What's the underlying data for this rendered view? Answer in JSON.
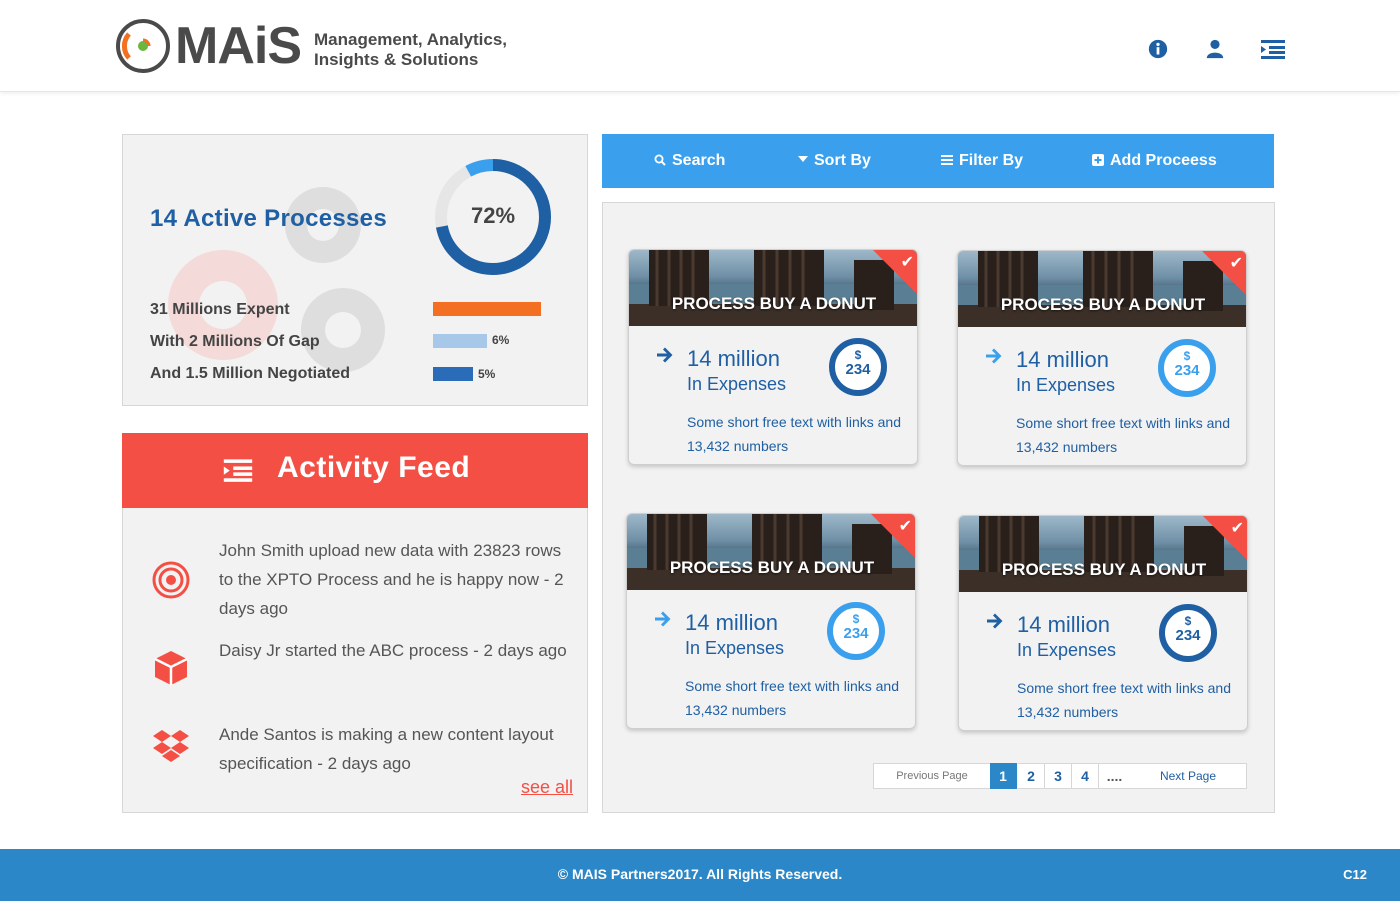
{
  "header": {
    "logo_word": "MAiS",
    "logo_tagline_1": "Management, Analytics,",
    "logo_tagline_2": "Insights & Solutions",
    "icons": [
      "info-icon",
      "user-icon",
      "menu-icon"
    ]
  },
  "stats": {
    "active_title": "14  Active Processes",
    "donut_percent": "72%",
    "donut_value": 0.72,
    "rows": [
      {
        "label": "31 Millions Expent",
        "bar_fraction": 1.0,
        "bar_label": ""
      },
      {
        "label": "With 2 Millions Of Gap",
        "bar_fraction": 0.5,
        "bar_label": "6%"
      },
      {
        "label": "And 1.5 Million Negotiated",
        "bar_fraction": 0.37,
        "bar_label": "5%"
      }
    ],
    "colors": {
      "orange": "#f36f21",
      "light_blue": "#a8c8ea",
      "blue": "#2b6cb8"
    }
  },
  "feed": {
    "title": "Activity Feed",
    "items": [
      {
        "icon": "target-icon",
        "text": "John Smith upload new data with 23823 rows to the XPTO Process and he is happy now - 2 days ago"
      },
      {
        "icon": "box-icon",
        "text": "Daisy Jr started the ABC process - 2 days ago"
      },
      {
        "icon": "dropbox-icon",
        "text": "Ande Santos is making a new content layout specification - 2 days ago"
      }
    ],
    "see_all": "see all"
  },
  "toolbar": {
    "search": "Search",
    "sort": "Sort By",
    "filter": "Filter By",
    "add": "Add Proceess"
  },
  "cards": [
    {
      "title": "PROCESS BUY A DONUT",
      "amount": "14 million",
      "sub": "In Expenses",
      "text": "Some short free text with links and 13,432 numbers",
      "badge_currency": "$",
      "badge_value": "234",
      "badge_style": "dark"
    },
    {
      "title": "PROCESS BUY A DONUT",
      "amount": "14 million",
      "sub": "In Expenses",
      "text": "Some short free text with links and 13,432 numbers",
      "badge_currency": "$",
      "badge_value": "234",
      "badge_style": "light"
    },
    {
      "title": "PROCESS BUY A DONUT",
      "amount": "14 million",
      "sub": "In Expenses",
      "text": "Some short free text with links and 13,432 numbers",
      "badge_currency": "$",
      "badge_value": "234",
      "badge_style": "light"
    },
    {
      "title": "PROCESS BUY A DONUT",
      "amount": "14 million",
      "sub": "In Expenses",
      "text": "Some short free text with links and 13,432 numbers",
      "badge_currency": "$",
      "badge_value": "234",
      "badge_style": "dark"
    }
  ],
  "pager": {
    "prev": "Previous Page",
    "pages": [
      "1",
      "2",
      "3",
      "4"
    ],
    "ellipsis": "....",
    "next": "Next Page",
    "active": "1"
  },
  "footer": {
    "copyright": "© MAIS Partners2017. All Rights Reserved.",
    "code": "C12"
  }
}
